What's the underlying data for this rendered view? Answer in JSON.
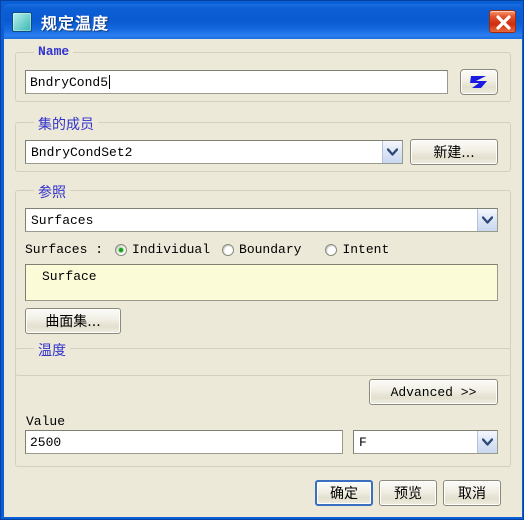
{
  "window": {
    "title": "规定温度",
    "title_icon": "app-square-icon",
    "close_label": "×",
    "accent_titlebar": "#0a5ad2",
    "client_bg": "#ece9d8",
    "legend_color": "#3333cc"
  },
  "name_group": {
    "legend": "Name",
    "value": "BndryCond5",
    "picker_icon": "blue-zigzag-icon"
  },
  "set_group": {
    "legend": "集的成员",
    "selected": "BndryCondSet2",
    "new_button": "新建..."
  },
  "reference_group": {
    "legend": "参照",
    "type_selected": "Surfaces",
    "radio_prefix": "Surfaces :",
    "radios": [
      {
        "label": "Individual",
        "selected": true
      },
      {
        "label": "Boundary",
        "selected": false
      },
      {
        "label": "Intent",
        "selected": false
      }
    ],
    "list_items": [
      "Surface"
    ],
    "surface_set_button": "曲面集..."
  },
  "temperature_group": {
    "legend": "温度",
    "advanced_button": "Advanced >>",
    "value_label": "Value",
    "value": "2500",
    "unit": "F"
  },
  "footer": {
    "ok": "确定",
    "preview": "预览",
    "cancel": "取消"
  }
}
